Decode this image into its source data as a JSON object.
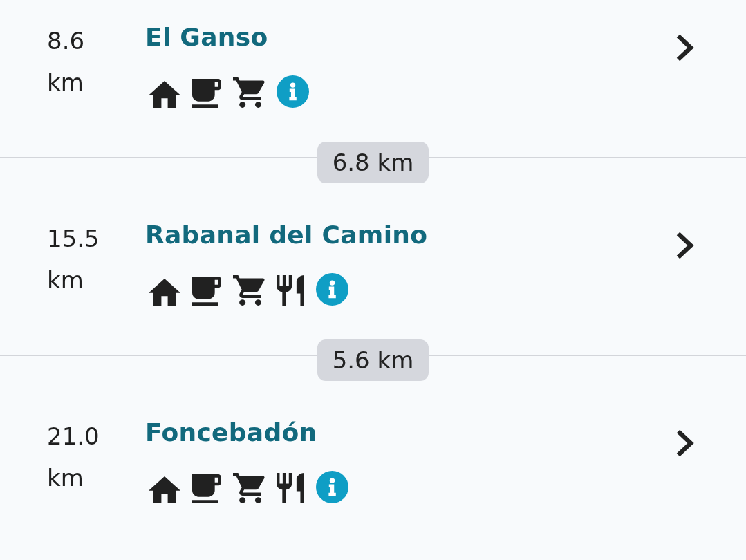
{
  "route": [
    {
      "kind": "stop",
      "distance": "8.6",
      "unit": "km",
      "name": "El Ganso",
      "amenities": [
        {
          "kind": "lodging"
        },
        {
          "kind": "cafe"
        },
        {
          "kind": "shop"
        },
        {
          "kind": "info"
        }
      ]
    },
    {
      "kind": "segment",
      "distance": "6.8 km"
    },
    {
      "kind": "stop",
      "distance": "15.5",
      "unit": "km",
      "name": "Rabanal del Camino",
      "amenities": [
        {
          "kind": "lodging"
        },
        {
          "kind": "cafe"
        },
        {
          "kind": "shop"
        },
        {
          "kind": "restaurant"
        },
        {
          "kind": "info"
        }
      ]
    },
    {
      "kind": "segment",
      "distance": "5.6 km"
    },
    {
      "kind": "stop",
      "distance": "21.0",
      "unit": "km",
      "name": "Foncebadón",
      "amenities": [
        {
          "kind": "lodging"
        },
        {
          "kind": "cafe"
        },
        {
          "kind": "shop"
        },
        {
          "kind": "restaurant"
        },
        {
          "kind": "info"
        }
      ]
    }
  ]
}
